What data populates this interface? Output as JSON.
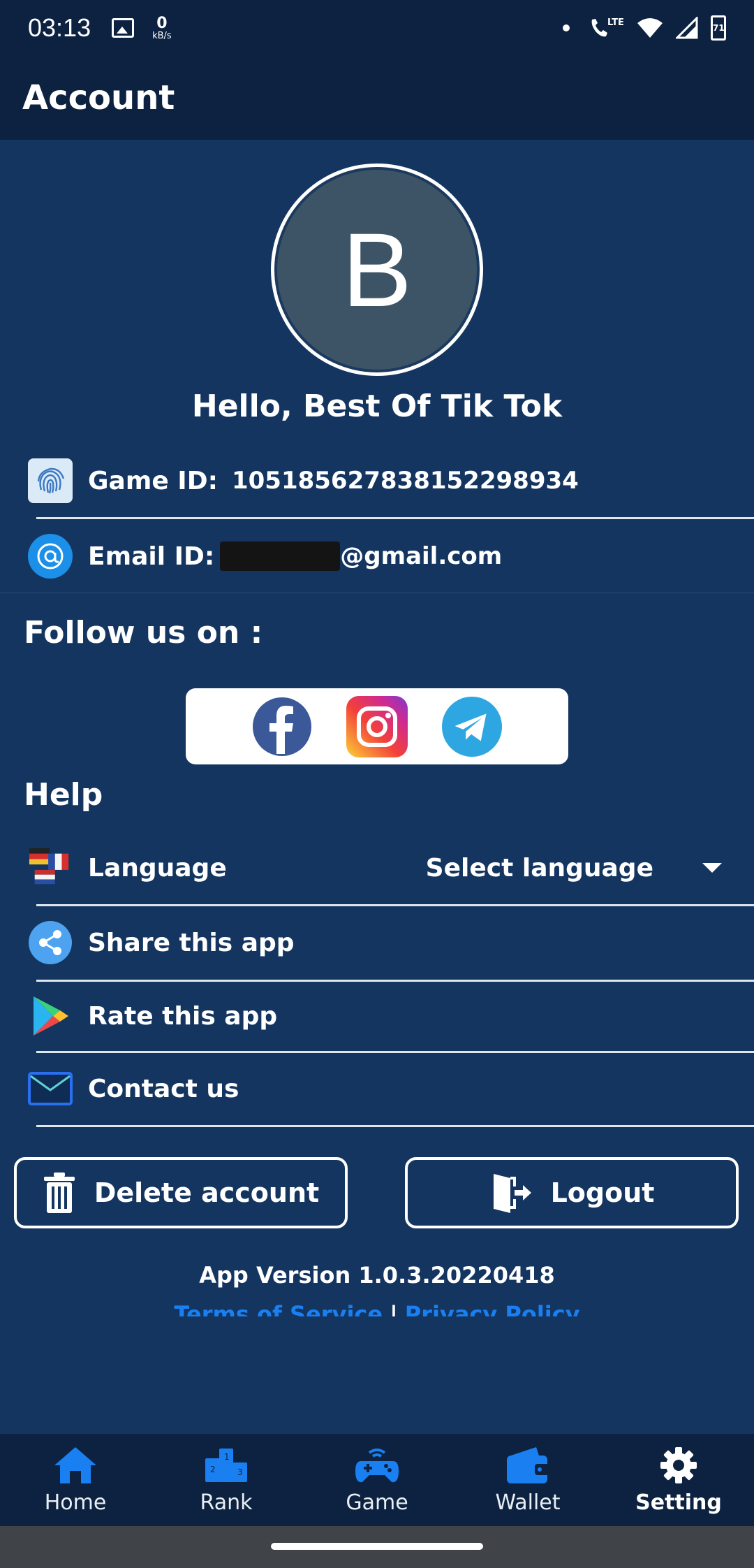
{
  "status_bar": {
    "time": "03:13",
    "speed_value": "0",
    "speed_unit": "kB/s",
    "network": "LTE",
    "battery": "71"
  },
  "app_bar": {
    "title": "Account"
  },
  "profile": {
    "avatar_letter": "B",
    "greeting": "Hello, Best Of Tik Tok"
  },
  "account_info": {
    "game_id_label": "Game ID:",
    "game_id_value": "105185627838152298934",
    "email_label": "Email ID:",
    "email_suffix": "@gmail.com"
  },
  "follow": {
    "title": "Follow us on :",
    "networks": [
      "facebook-icon",
      "instagram-icon",
      "telegram-icon"
    ]
  },
  "help": {
    "title": "Help",
    "language_label": "Language",
    "language_select": "Select language",
    "share_label": "Share this app",
    "rate_label": "Rate this app",
    "contact_label": "Contact us"
  },
  "actions": {
    "delete_label": "Delete account",
    "logout_label": "Logout"
  },
  "footer": {
    "version": "App Version 1.0.3.20220418",
    "terms": "Terms of Service",
    "separator": "|",
    "privacy": "Privacy Policy"
  },
  "bottom_nav": {
    "items": [
      {
        "label": "Home",
        "icon": "home-icon"
      },
      {
        "label": "Rank",
        "icon": "podium-icon"
      },
      {
        "label": "Game",
        "icon": "gamepad-icon"
      },
      {
        "label": "Wallet",
        "icon": "wallet-icon"
      },
      {
        "label": "Setting",
        "icon": "gear-icon",
        "active": true
      }
    ]
  },
  "colors": {
    "background": "#133560",
    "header": "#0c2240",
    "accent": "#1a7ff0",
    "avatar_bg": "#3d5466"
  }
}
